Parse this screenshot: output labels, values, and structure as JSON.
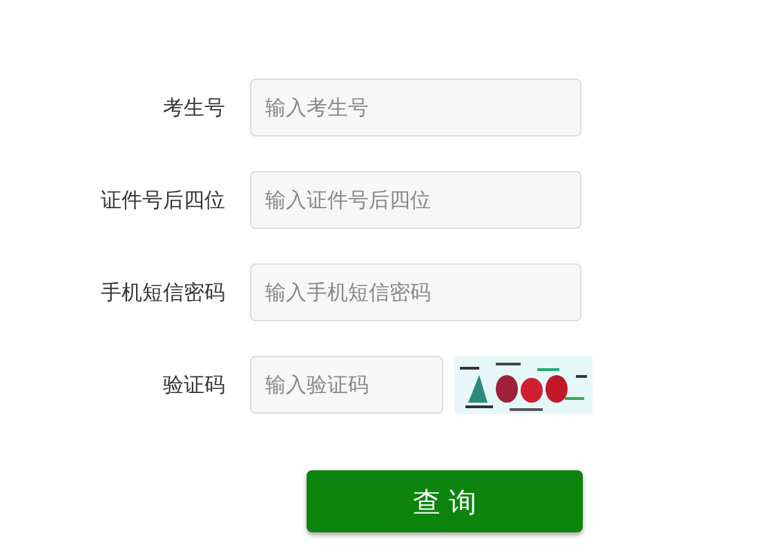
{
  "fields": [
    {
      "label": "考生号",
      "placeholder": "输入考生号",
      "kind": "text"
    },
    {
      "label": "证件号后四位",
      "placeholder": "输入证件号后四位",
      "kind": "text"
    },
    {
      "label": "手机短信密码",
      "placeholder": "输入手机短信密码",
      "kind": "text"
    },
    {
      "label": "验证码",
      "placeholder": "输入验证码",
      "kind": "captcha"
    }
  ],
  "submit_button": "查 询"
}
